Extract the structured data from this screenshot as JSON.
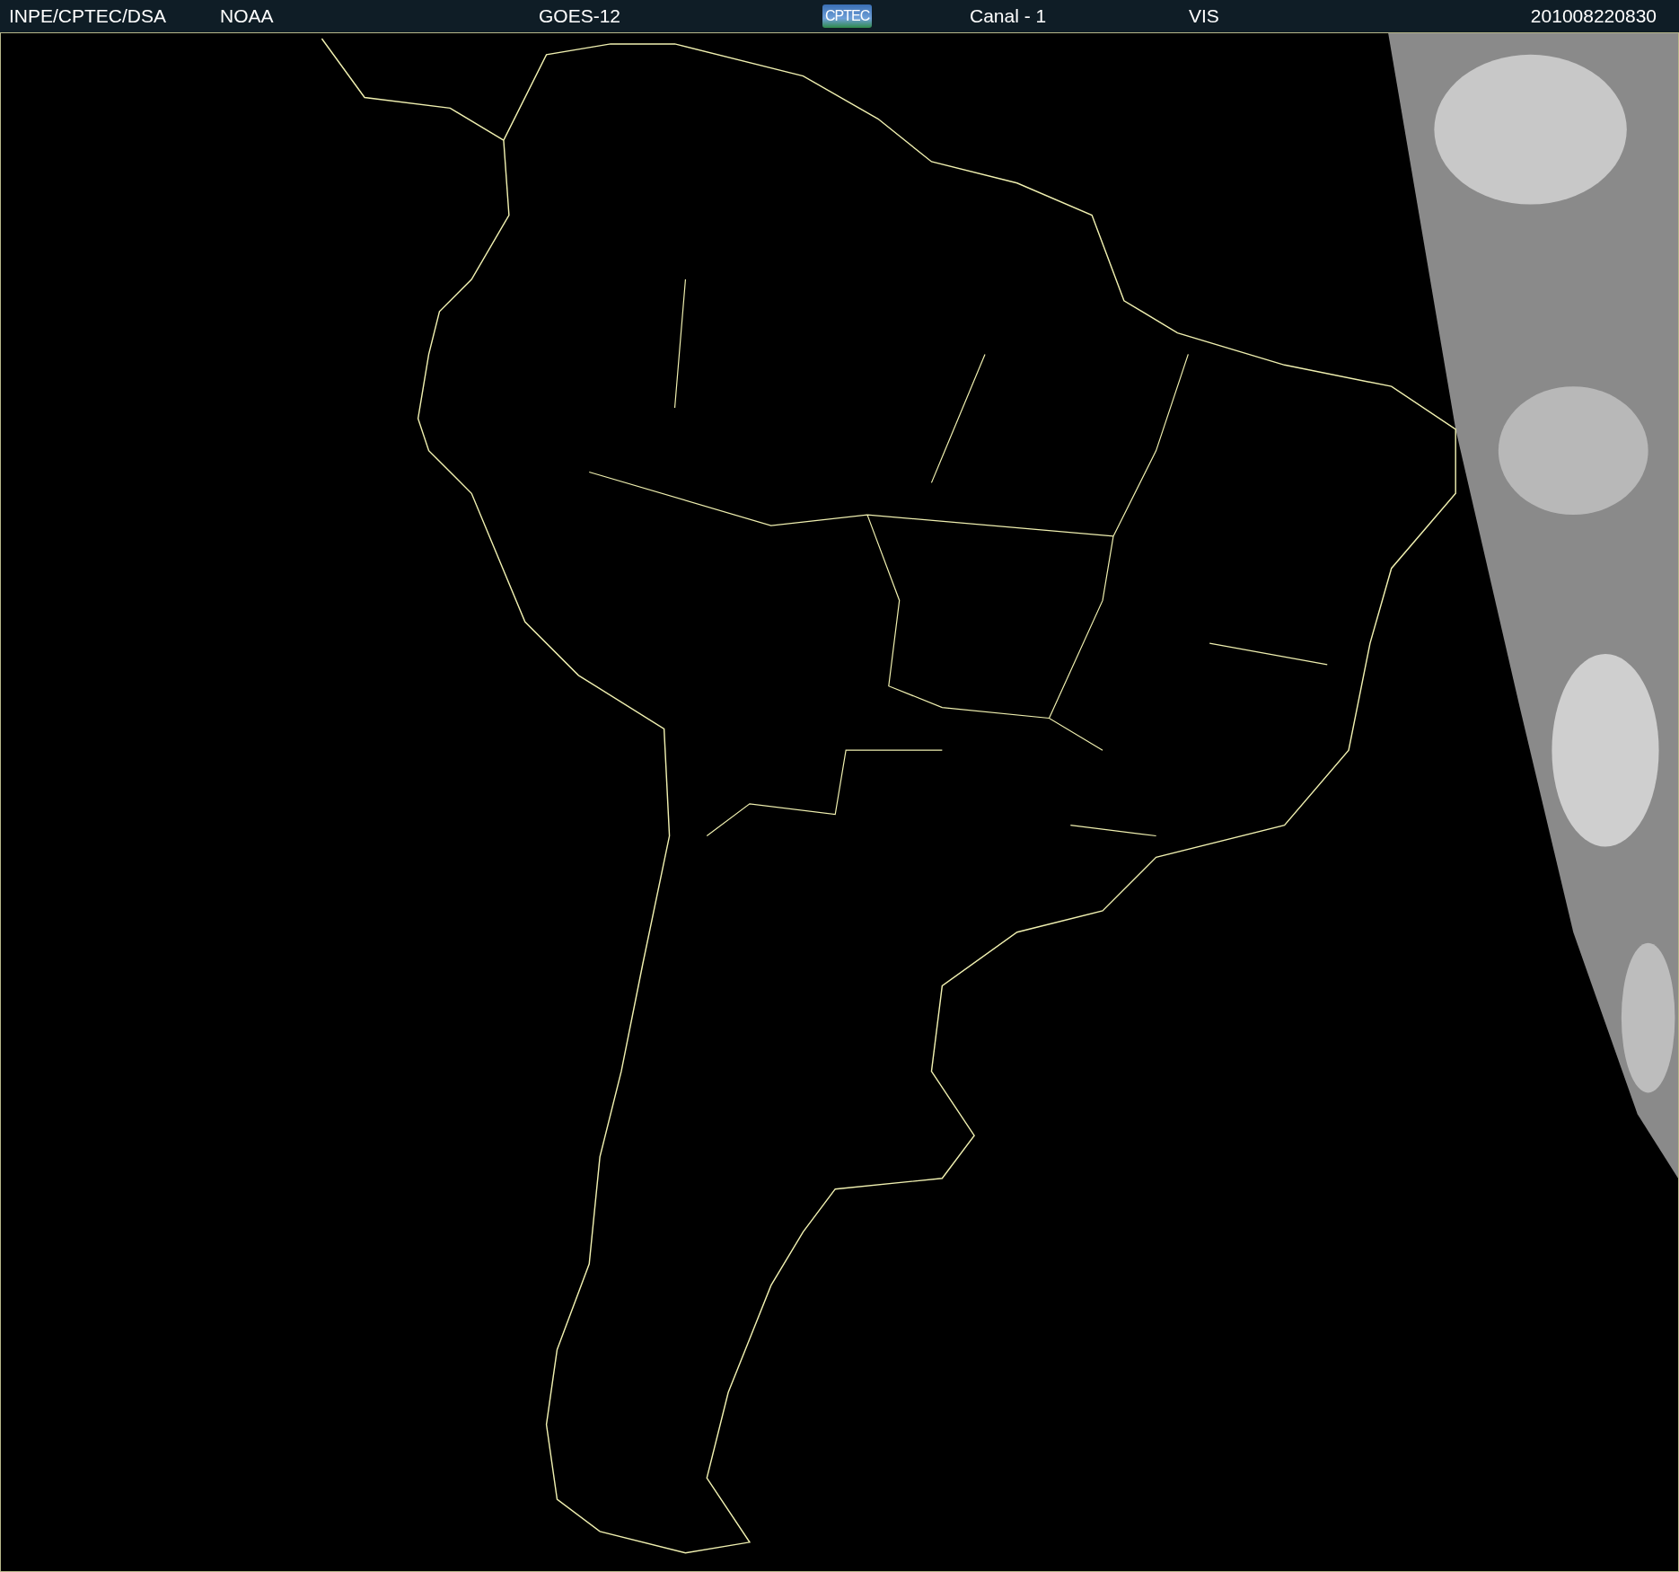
{
  "header": {
    "items": [
      {
        "kind": "text",
        "text": "INPE/CPTEC/DSA"
      },
      {
        "kind": "text",
        "text": "NOAA"
      },
      {
        "kind": "text",
        "text": "GOES-12"
      },
      {
        "kind": "logo",
        "text": "CPTEC"
      },
      {
        "kind": "text",
        "text": "Canal - 1"
      },
      {
        "kind": "text",
        "text": "VIS"
      },
      {
        "kind": "text",
        "text": "201008220830"
      }
    ]
  }
}
